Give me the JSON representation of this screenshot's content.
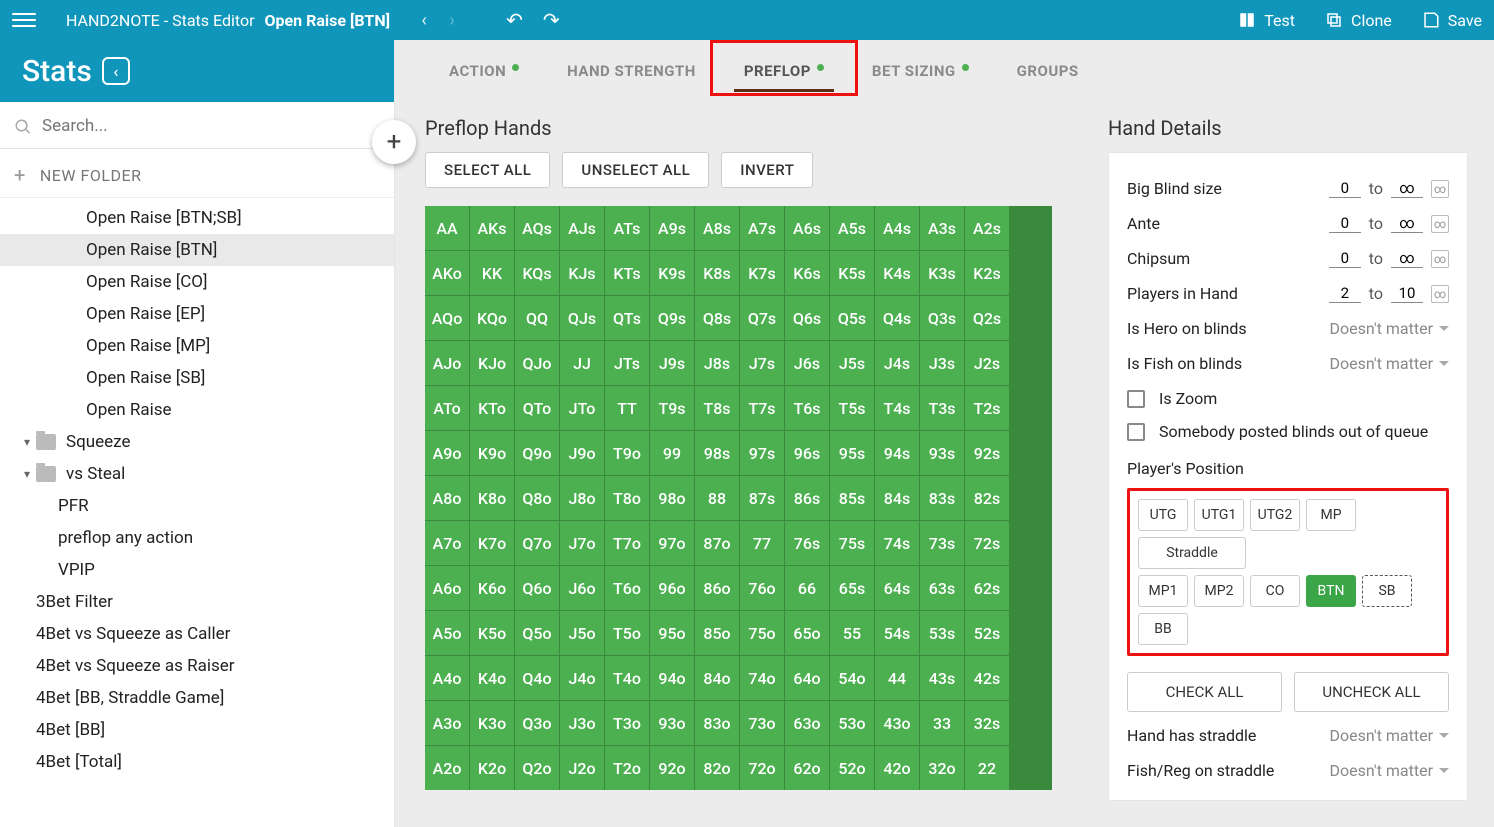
{
  "title": {
    "app": "HAND2NOTE - Stats Editor",
    "doc": "Open Raise [BTN]"
  },
  "title_actions": {
    "test": "Test",
    "clone": "Clone",
    "save": "Save"
  },
  "stats_header": "Stats",
  "search_placeholder": "Search...",
  "new_folder": "NEW FOLDER",
  "tree": [
    {
      "label": "Open Raise [BTN;SB]",
      "indent": 86
    },
    {
      "label": "Open Raise [BTN]",
      "indent": 86,
      "selected": true
    },
    {
      "label": "Open Raise [CO]",
      "indent": 86
    },
    {
      "label": "Open Raise [EP]",
      "indent": 86
    },
    {
      "label": "Open Raise [MP]",
      "indent": 86
    },
    {
      "label": "Open Raise [SB]",
      "indent": 86
    },
    {
      "label": "Open Raise",
      "indent": 86
    },
    {
      "label": "Squeeze",
      "indent": 36,
      "folder": true,
      "chev": true
    },
    {
      "label": "vs Steal",
      "indent": 36,
      "folder": true,
      "chev": true
    },
    {
      "label": "PFR",
      "indent": 58
    },
    {
      "label": "preflop any action",
      "indent": 58
    },
    {
      "label": "VPIP",
      "indent": 58
    },
    {
      "label": "3Bet Filter",
      "indent": 36
    },
    {
      "label": "4Bet vs Squeeze as Caller",
      "indent": 36
    },
    {
      "label": "4Bet vs Squeeze as Raiser",
      "indent": 36
    },
    {
      "label": "4Bet [BB, Straddle Game]",
      "indent": 36
    },
    {
      "label": "4Bet [BB]",
      "indent": 36
    },
    {
      "label": "4Bet [Total]",
      "indent": 36
    }
  ],
  "tabs": [
    {
      "label": "ACTION",
      "dot": true
    },
    {
      "label": "HAND STRENGTH"
    },
    {
      "label": "PREFLOP",
      "dot": true,
      "active": true,
      "highlight": true
    },
    {
      "label": "BET SIZING",
      "dot": true
    },
    {
      "label": "GROUPS"
    }
  ],
  "hands": {
    "title": "Preflop Hands",
    "buttons": {
      "select_all": "SELECT ALL",
      "unselect_all": "UNSELECT ALL",
      "invert": "INVERT"
    },
    "ranks": [
      "A",
      "K",
      "Q",
      "J",
      "T",
      "9",
      "8",
      "7",
      "6",
      "5",
      "4",
      "3",
      "2"
    ]
  },
  "details": {
    "title": "Hand Details",
    "bb": {
      "label": "Big Blind size",
      "from": "0",
      "to_lbl": "to",
      "to": "∞"
    },
    "ante": {
      "label": "Ante",
      "from": "0",
      "to_lbl": "to",
      "to": "∞"
    },
    "chipsum": {
      "label": "Chipsum",
      "from": "0",
      "to_lbl": "to",
      "to": "∞"
    },
    "players": {
      "label": "Players in Hand",
      "from": "2",
      "to_lbl": "to",
      "to": "10"
    },
    "hero_blinds": {
      "label": "Is Hero on blinds",
      "value": "Doesn't matter"
    },
    "fish_blinds": {
      "label": "Is Fish on blinds",
      "value": "Doesn't matter"
    },
    "is_zoom": "Is Zoom",
    "posted_ooq": "Somebody posted blinds out of queue",
    "player_position": "Player's Position",
    "positions_row1": [
      {
        "lbl": "UTG"
      },
      {
        "lbl": "UTG1"
      },
      {
        "lbl": "UTG2"
      },
      {
        "lbl": "MP"
      },
      {
        "lbl": "Straddle",
        "wide": true
      }
    ],
    "positions_row2": [
      {
        "lbl": "MP1"
      },
      {
        "lbl": "MP2"
      },
      {
        "lbl": "CO"
      },
      {
        "lbl": "BTN",
        "sel": true
      },
      {
        "lbl": "SB",
        "dashed": true
      },
      {
        "lbl": "BB"
      }
    ],
    "check_all": "CHECK ALL",
    "uncheck_all": "UNCHECK ALL",
    "straddle": {
      "label": "Hand has straddle",
      "value": "Doesn't matter"
    },
    "fish_reg": {
      "label": "Fish/Reg on straddle",
      "value": "Doesn't matter"
    }
  }
}
